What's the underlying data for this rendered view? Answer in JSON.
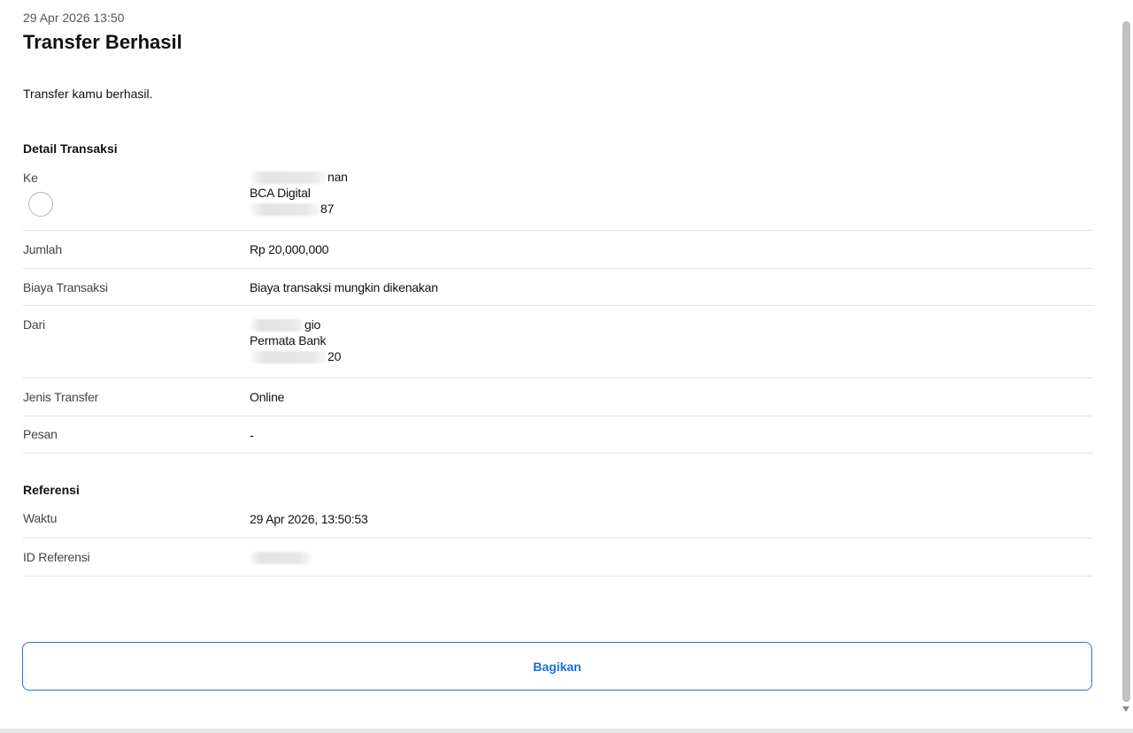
{
  "header": {
    "timestamp": "29 Apr 2026 13:50",
    "title": "Transfer Berhasil",
    "status_message": "Transfer kamu berhasil."
  },
  "detail": {
    "section_title": "Detail Transaksi",
    "to": {
      "label": "Ke",
      "name_suffix": "nan",
      "bank": "BCA Digital",
      "account_suffix": "87"
    },
    "amount": {
      "label": "Jumlah",
      "value": "Rp 20,000,000"
    },
    "fee": {
      "label": "Biaya Transaksi",
      "value": "Biaya transaksi mungkin dikenakan"
    },
    "from": {
      "label": "Dari",
      "name_suffix": "gio",
      "bank": "Permata Bank",
      "account_suffix": "20"
    },
    "transfer_type": {
      "label": "Jenis Transfer",
      "value": "Online"
    },
    "message": {
      "label": "Pesan",
      "value": "-"
    }
  },
  "reference": {
    "section_title": "Referensi",
    "time": {
      "label": "Waktu",
      "value": "29 Apr 2026, 13:50:53"
    },
    "reference_id": {
      "label": "ID Referensi"
    }
  },
  "actions": {
    "share_label": "Bagikan"
  },
  "colors": {
    "accent": "#1a73e8",
    "divider": "#e2e2e2"
  }
}
